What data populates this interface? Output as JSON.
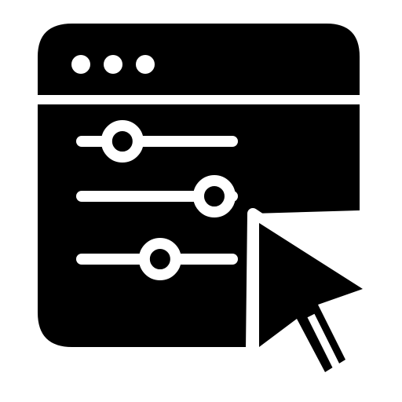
{
  "icon": {
    "name": "browser-settings-sliders-cursor-icon",
    "colors": {
      "foreground": "#000000",
      "background": "#ffffff"
    },
    "window": {
      "title_dots": 3
    },
    "sliders": [
      {
        "name": "slider-1",
        "value": 0.27
      },
      {
        "name": "slider-2",
        "value": 0.88
      },
      {
        "name": "slider-3",
        "value": 0.52
      }
    ],
    "cursor": {
      "name": "arrow-cursor-icon"
    }
  }
}
